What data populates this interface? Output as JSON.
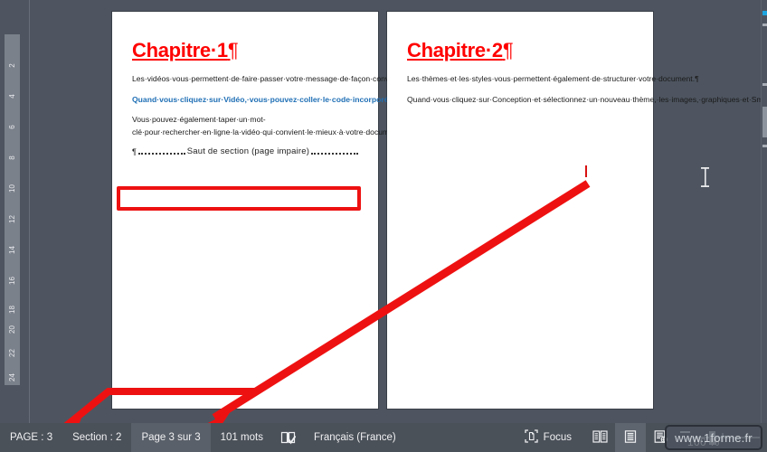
{
  "app": {
    "name": "Microsoft Word",
    "view_mode": "Print Layout",
    "background_color": "#4e5560",
    "accent_red": "#ee1111"
  },
  "ruler": {
    "orientation": "vertical",
    "unit": "cm",
    "ticks": [
      "2",
      "4",
      "6",
      "8",
      "10",
      "12",
      "14",
      "16",
      "18",
      "20",
      "22",
      "24"
    ]
  },
  "document": {
    "pages": [
      {
        "number": 1,
        "heading": "Chapitre·1",
        "heading_mark": "¶",
        "paragraphs": [
          {
            "style": "normal",
            "text": "Les·vidéos·vous·permettent·de·faire·passer·votre·message·de·façon·convaincante.",
            "mark": "¶"
          },
          {
            "style": "emphasis-blue",
            "text": "Quand·vous·cliquez·sur·Vidéo,·vous·pouvez·coller·le·code·incorporé·de·la·vidéo·que·vous·souhaitez·ajouter.",
            "mark": "¶"
          },
          {
            "style": "normal",
            "text": "Vous·pouvez·également·taper·un·mot-clé·pour·rechercher·en·ligne·la·vidéo·qui·convient·le·mieux·à·votre·document",
            "mark": "¶"
          }
        ],
        "section_break": {
          "mark": "¶",
          "label": "Saut de section (page impaire)",
          "highlighted": true
        }
      },
      {
        "number": 2,
        "heading": "Chapitre·2",
        "heading_mark": "¶",
        "paragraphs": [
          {
            "style": "normal",
            "text": "Les·thèmes·et·les·styles·vous·permettent·également·de·structurer·votre·document.",
            "mark": "¶"
          },
          {
            "style": "normal",
            "text": "Quand·vous·cliquez·sur·Conception·et·sélectionnez·un·nouveau·thème,·les·images,·graphiques·et·SmartArt·sont·modifiés·pour·correspondre·au·nouveau·thème·choisi.·Quand·vous·appliquez·des·styles,·les·titres·changent·pour·refléter·le·nouveau·thème.",
            "mark": "¶"
          }
        ],
        "section_break": null
      }
    ]
  },
  "annotations": {
    "highlight_boxes": [
      "section-break",
      "PAGE : 3",
      "Page 3 sur 3"
    ],
    "arrow_color": "#ee1111",
    "arrow_description": "Arrow from text caret on page 2 pointing to PAGE : 3 and Page 3 sur 3 in status bar"
  },
  "statusbar": {
    "page_indicator": "PAGE : 3",
    "section_indicator": "Section : 2",
    "page_of_total": "Page 3 sur 3",
    "word_count": "101 mots",
    "proofing_icon": "proofing-book-check-icon",
    "language": "Français (France)",
    "focus_label": "Focus",
    "focus_icon": "focus-mode-icon",
    "view_buttons": [
      {
        "name": "read-mode",
        "icon": "open-book-icon",
        "active": false
      },
      {
        "name": "print-layout",
        "icon": "page-layout-icon",
        "active": true
      },
      {
        "name": "web-layout",
        "icon": "page-globe-icon",
        "active": false
      }
    ],
    "zoom": {
      "minus_label": "−",
      "plus_label": "+",
      "percent": "100 %",
      "slider_value": 100
    },
    "watermark": "www.1forme.fr"
  }
}
